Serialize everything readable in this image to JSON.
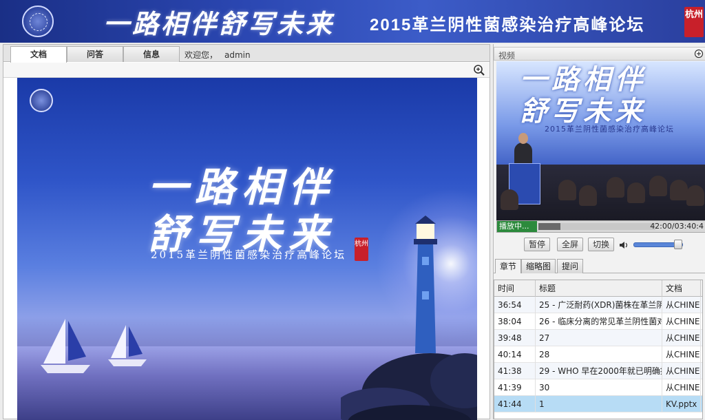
{
  "header": {
    "calligraphy": "一路相伴舒写未来",
    "forum_title": "2015革兰阴性菌感染治疗高峰论坛",
    "seal": "杭州"
  },
  "left": {
    "tabs": [
      {
        "label": "文档",
        "active": true
      },
      {
        "label": "问答",
        "active": false
      },
      {
        "label": "信息",
        "active": false
      }
    ],
    "welcome_text": "欢迎您，",
    "username": "admin",
    "slide": {
      "calli_line1": "一路相伴",
      "calli_line2": "舒写未来",
      "subtitle": "2015革兰阴性菌感染治疗高峰论坛",
      "seal": "杭州"
    }
  },
  "right": {
    "video_label": "视频",
    "video_screen": {
      "calligraphy": "一路相伴\n舒写未来",
      "subtitle": "2015革兰阴性菌感染治疗高峰论坛"
    },
    "player": {
      "status": "播放中...",
      "time": "42:00/03:40:4",
      "progress": 0.19
    },
    "controls": {
      "pause": "暂停",
      "fullscreen": "全屏",
      "switch": "切换",
      "volume": 0.85
    },
    "subtabs": [
      {
        "label": "章节",
        "active": true
      },
      {
        "label": "缩略图",
        "active": false
      },
      {
        "label": "提问",
        "active": false
      }
    ],
    "grid": {
      "columns": [
        "时间",
        "标题",
        "文档"
      ],
      "rows": [
        {
          "time": "36:54",
          "title": "25 - 广泛耐药(XDR)菌株在革兰阴",
          "doc": "从CHINE",
          "selected": false
        },
        {
          "time": "38:04",
          "title": "26 - 临床分离的常见革兰阴性菌对",
          "doc": "从CHINE",
          "selected": false
        },
        {
          "time": "39:48",
          "title": "27",
          "doc": "从CHINE",
          "selected": false
        },
        {
          "time": "40:14",
          "title": "28",
          "doc": "从CHINE",
          "selected": false
        },
        {
          "time": "41:38",
          "title": "29 - WHO 早在2000年就已明确提",
          "doc": "从CHINE",
          "selected": false
        },
        {
          "time": "41:39",
          "title": "30",
          "doc": "从CHINE",
          "selected": false
        },
        {
          "time": "41:44",
          "title": "1",
          "doc": "KV.pptx",
          "selected": true
        }
      ]
    }
  },
  "colors": {
    "header_blue": "#2b47b2",
    "status_green": "#2c8a3c",
    "selected_row": "#b7dcf5",
    "seal_red": "#c8202a"
  }
}
